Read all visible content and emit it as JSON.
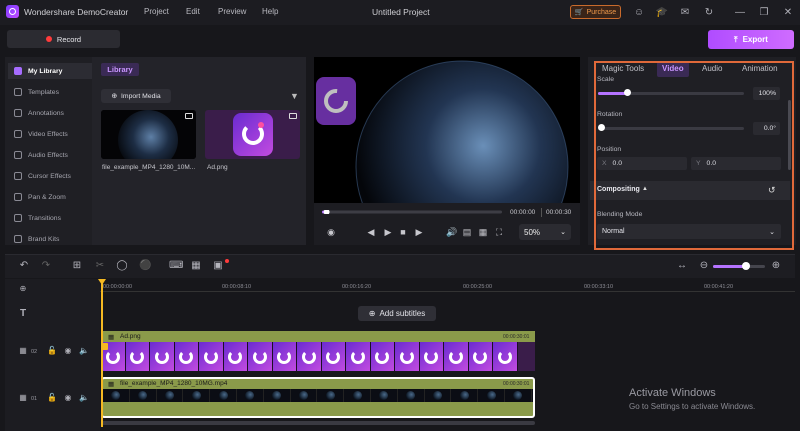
{
  "titlebar": {
    "app_name": "Wondershare DemoCreator",
    "menu": [
      "Project",
      "Edit",
      "Preview",
      "Help"
    ],
    "project_title": "Untitled Project",
    "purchase_label": "Purchase"
  },
  "toolbar": {
    "record_label": "Record",
    "export_label": "Export"
  },
  "sidebar": {
    "items": [
      {
        "label": "My Library",
        "icon": "library-icon",
        "active": true
      },
      {
        "label": "Templates",
        "icon": "templates-icon"
      },
      {
        "label": "Annotations",
        "icon": "annotations-icon"
      },
      {
        "label": "Video Effects",
        "icon": "video-effects-icon"
      },
      {
        "label": "Audio Effects",
        "icon": "audio-effects-icon"
      },
      {
        "label": "Cursor Effects",
        "icon": "cursor-effects-icon"
      },
      {
        "label": "Pan & Zoom",
        "icon": "pan-zoom-icon"
      },
      {
        "label": "Transitions",
        "icon": "transitions-icon"
      },
      {
        "label": "Brand Kits",
        "icon": "brand-kits-icon"
      }
    ]
  },
  "library": {
    "tag": "Library",
    "import_label": "Import Media",
    "items": [
      {
        "name": "file_example_MP4_1280_10M...",
        "type": "video"
      },
      {
        "name": "Ad.png",
        "type": "image"
      }
    ]
  },
  "preview": {
    "time_current": "00:00:00",
    "time_total": "00:00:30",
    "zoom": "50%",
    "progress": 0.02
  },
  "properties": {
    "tabs": [
      "Magic Tools",
      "Video",
      "Audio",
      "Animation"
    ],
    "active_tab": "Video",
    "scale_label": "Scale",
    "scale_value": "100%",
    "scale_fraction": 0.2,
    "rotation_label": "Rotation",
    "rotation_value": "0.0°",
    "rotation_fraction": 0.0,
    "position_label": "Position",
    "position_x": "0.0",
    "position_y": "0.0",
    "axis_x": "X",
    "axis_y": "Y",
    "compositing_label": "Compositing",
    "blending_label": "Blending Mode",
    "blending_value": "Normal"
  },
  "timeline": {
    "ruler_ticks": [
      "00:00:00:00",
      "00:00:08:10",
      "00:00:16:20",
      "00:00:25:00",
      "00:00:33:10",
      "00:00:41:20"
    ],
    "add_subtitles_label": "Add subtitles",
    "tracks": [
      {
        "number": "02",
        "clip_name": "Ad.png",
        "clip_time": "00:00:30:01"
      },
      {
        "number": "01",
        "clip_name": "file_example_MP4_1280_10MG.mp4",
        "clip_time": "00:00:30:01"
      }
    ],
    "zoom_fraction": 0.6
  },
  "watermark": {
    "title": "Activate Windows",
    "subtitle": "Go to Settings to activate Windows."
  },
  "colors": {
    "accent": "#b573ff",
    "export": "#c05cff",
    "highlight_frame": "#e0693a",
    "playhead": "#f5b922",
    "clip_header": "#8a9a4a"
  }
}
